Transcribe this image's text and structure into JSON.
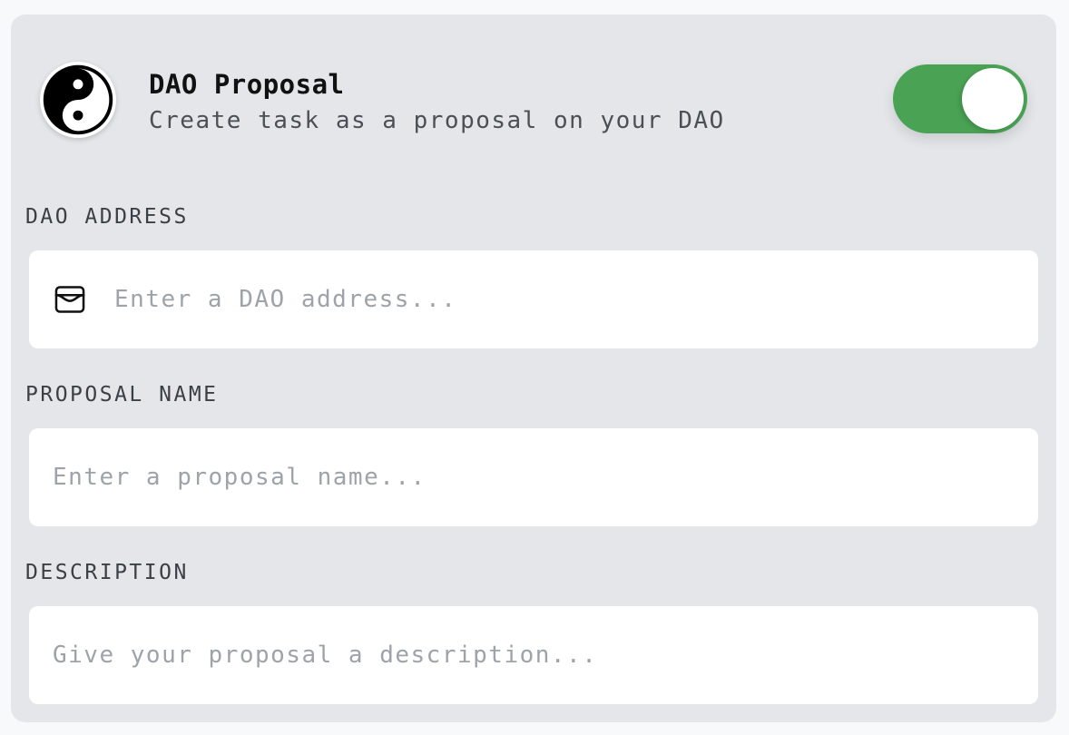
{
  "proposal": {
    "title": "DAO Proposal",
    "subtitle": "Create task as a proposal on your DAO",
    "logo_icon": "yin-yang-icon",
    "toggle_enabled": true,
    "toggle_color": "#4aa354"
  },
  "fields": {
    "dao_address": {
      "label": "DAO ADDRESS",
      "placeholder": "Enter a DAO address...",
      "value": "",
      "icon": "wallet-icon"
    },
    "proposal_name": {
      "label": "PROPOSAL NAME",
      "placeholder": "Enter a proposal name...",
      "value": ""
    },
    "description": {
      "label": "DESCRIPTION",
      "placeholder": "Give your proposal a description...",
      "value": ""
    }
  }
}
